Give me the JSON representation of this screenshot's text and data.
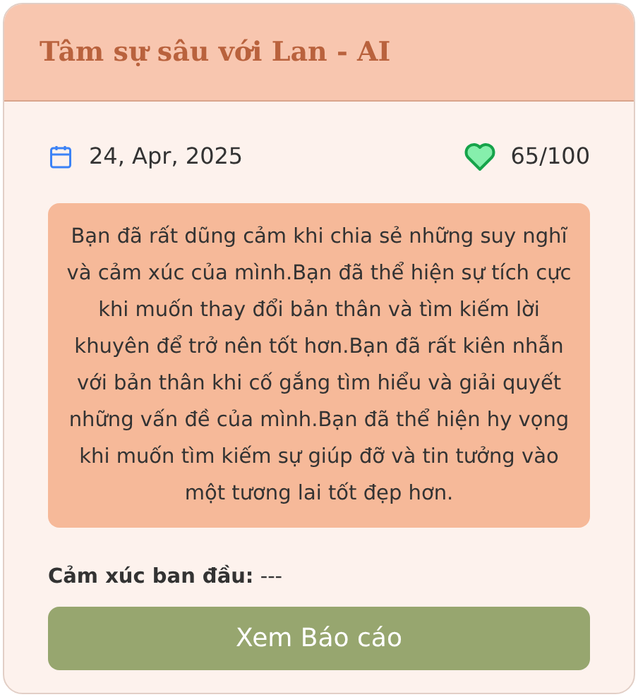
{
  "title": "Tâm sự sâu với Lan - AI",
  "date": "24, Apr, 2025",
  "score": "65/100",
  "summary": "Bạn đã rất dũng cảm khi chia sẻ những suy nghĩ và cảm xúc của mình.Bạn đã thể hiện sự tích cực khi muốn thay đổi bản thân và tìm kiếm lời khuyên để trở nên tốt hơn.Bạn đã rất kiên nhẫn với bản thân khi cố gắng tìm hiểu và giải quyết những vấn đề của mình.Bạn đã thể hiện hy vọng khi muốn tìm kiếm sự giúp đỡ và tin tưởng vào một tương lai tốt đẹp hơn.",
  "initial_emotion": "**Cảm xúc ban đầu:** ---",
  "button": "Xem Báo cáo"
}
